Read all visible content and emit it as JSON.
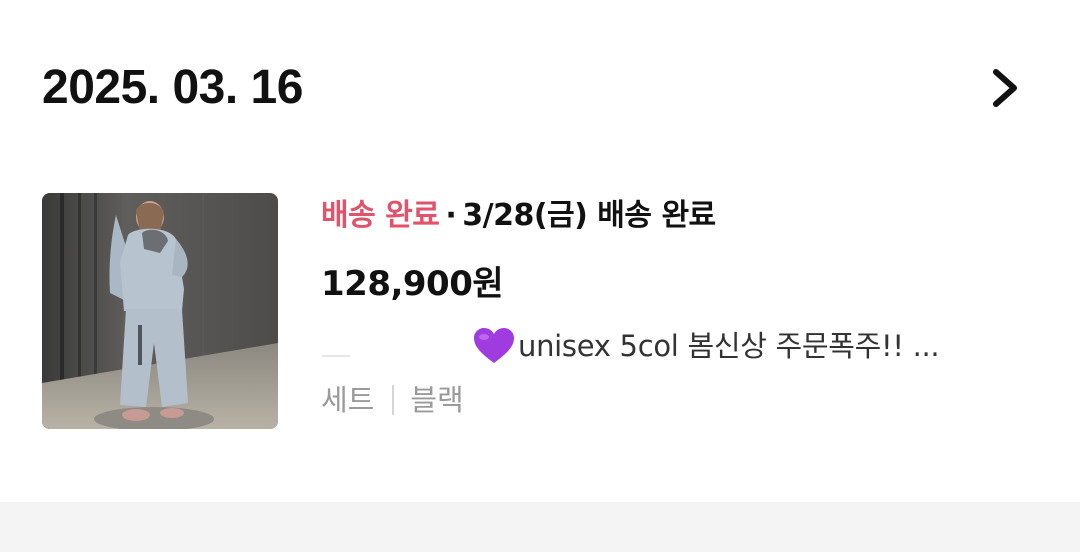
{
  "order": {
    "date": "2025. 03. 16",
    "status_label": "배송 완료",
    "status_separator": "·",
    "status_detail": "3/28(금) 배송 완료",
    "price": "128,900원",
    "product_name": "unisex 5col 봄신상 주문폭주!! ...",
    "product_icon": "purple-heart-icon",
    "option_1": "세트",
    "option_2": "블랙"
  },
  "colors": {
    "status_accent": "#e0536a",
    "heart": "#a03be0",
    "muted_text": "#9a9a9a",
    "divider_band": "#f4f4f4"
  }
}
